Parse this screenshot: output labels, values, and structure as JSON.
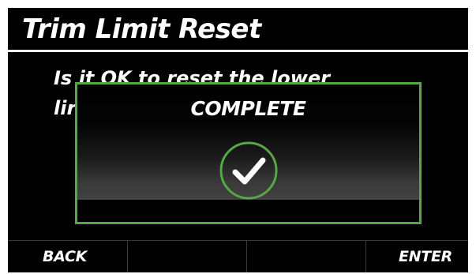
{
  "header": {
    "title": "Trim Limit Reset"
  },
  "message": {
    "line1": "Is it OK to reset the lower",
    "line2": "lir"
  },
  "dialog": {
    "title": "COMPLETE",
    "icon": "check-circle-icon"
  },
  "softkeys": {
    "back": "BACK",
    "key2": "",
    "key3": "",
    "enter": "ENTER"
  },
  "colors": {
    "background": "#000000",
    "text": "#ffffff",
    "dialog_border": "#55a845",
    "check_ring": "#55a845"
  }
}
